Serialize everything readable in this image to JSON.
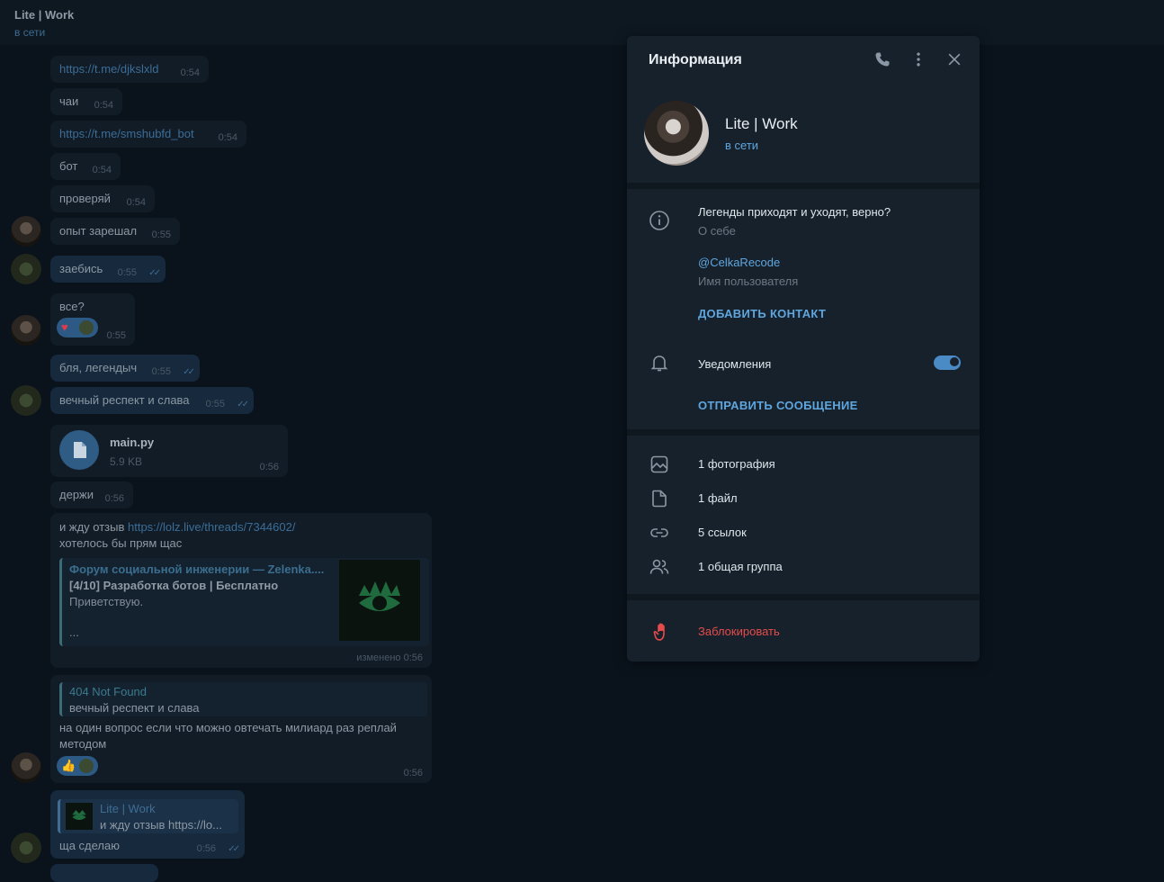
{
  "header": {
    "title": "Lite | Work",
    "status": "в сети"
  },
  "messages": {
    "m1": {
      "text": "https://t.me/djkslxld",
      "time": "0:54"
    },
    "m2": {
      "text": "чаи",
      "time": "0:54"
    },
    "m3": {
      "text": "https://t.me/smshubfd_bot",
      "time": "0:54"
    },
    "m4": {
      "text": "бот",
      "time": "0:54"
    },
    "m5": {
      "text": "проверяй",
      "time": "0:54"
    },
    "m6": {
      "text": "опыт зарешал",
      "time": "0:55"
    },
    "m7": {
      "text": "заебись",
      "time": "0:55"
    },
    "m8": {
      "text": "все?",
      "time": "0:55"
    },
    "m9": {
      "text": "бля, легендыч",
      "time": "0:55"
    },
    "m10": {
      "text": "вечный респект и слава",
      "time": "0:55"
    },
    "file": {
      "name": "main.py",
      "size": "5.9 KB",
      "time": "0:56"
    },
    "m11": {
      "text": "держи",
      "time": "0:56"
    },
    "m12": {
      "text_prefix": "и жду отзыв ",
      "link": "https://lolz.live/threads/7344602/",
      "text_line2": "хотелось бы прям щас",
      "preview_site": "Форум социальной инженерии — Zelenka....",
      "preview_title": "[4/10] Разработка ботов | Бесплатно",
      "preview_desc": "Приветствую.",
      "preview_more": "...",
      "time": "изменено 0:56"
    },
    "m13": {
      "reply_name": "404 Not Found",
      "reply_text": "вечный респект и слава",
      "text": "на один вопрос если что можно овтечать милиард раз реплай методом",
      "time": "0:56"
    },
    "m14": {
      "reply_name": "Lite | Work",
      "reply_text": "и жду отзыв https://lo...",
      "text": "ща сделаю",
      "time": "0:56"
    }
  },
  "panel": {
    "title": "Информация",
    "name": "Lite | Work",
    "status": "в сети",
    "bio": "Легенды приходят и уходят, верно?",
    "bio_label": "О себе",
    "username": "@CelkaRecode",
    "username_label": "Имя пользователя",
    "add_contact": "ДОБАВИТЬ КОНТАКТ",
    "notifications": "Уведомления",
    "notifications_on": true,
    "send_message": "ОТПРАВИТЬ СООБЩЕНИЕ",
    "media": [
      {
        "icon": "photo-icon",
        "label": "1 фотография"
      },
      {
        "icon": "file-icon",
        "label": "1 файл"
      },
      {
        "icon": "link-icon",
        "label": "5 ссылок"
      },
      {
        "icon": "group-icon",
        "label": "1 общая группа"
      }
    ],
    "block": "Заблокировать"
  },
  "colors": {
    "accent": "#5fa6df",
    "danger": "#e64b4b",
    "panel_bg": "#17212b",
    "chat_bg": "#0a131c"
  }
}
